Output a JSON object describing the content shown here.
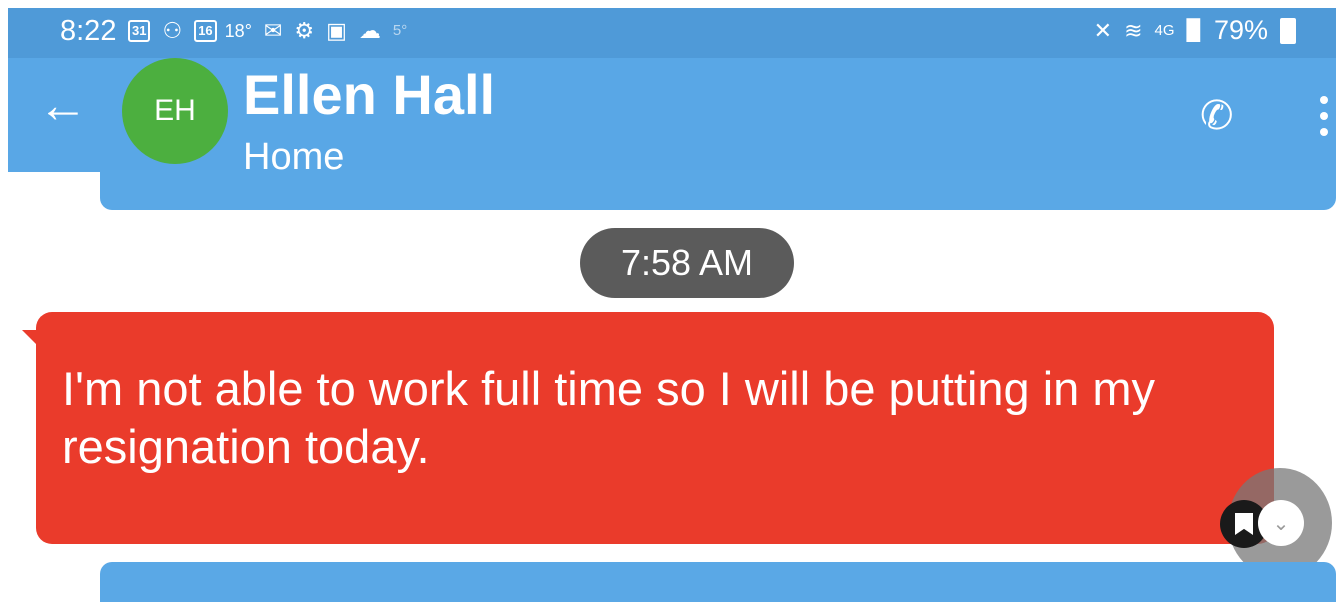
{
  "status_bar": {
    "time": "8:22",
    "icons": [
      "calendar-icon",
      "snapchat-icon",
      "calendar-icon",
      "mail-icon",
      "settings-icon",
      "gallery-icon",
      "cloud-icon"
    ],
    "calendar_day": "31",
    "calendar_day2": "16",
    "temp": "18°",
    "temp2": "5°",
    "network": "4G",
    "battery": "79%"
  },
  "app_bar": {
    "avatar_initials": "EH",
    "contact_name": "Ellen Hall",
    "contact_sub": "Home",
    "accent": "#59a7e6"
  },
  "conversation": {
    "timestamp": "7:58 AM",
    "message": "I'm not able to work full time so I will be putting in my resignation today.",
    "message_color": "#ea3b2b"
  }
}
